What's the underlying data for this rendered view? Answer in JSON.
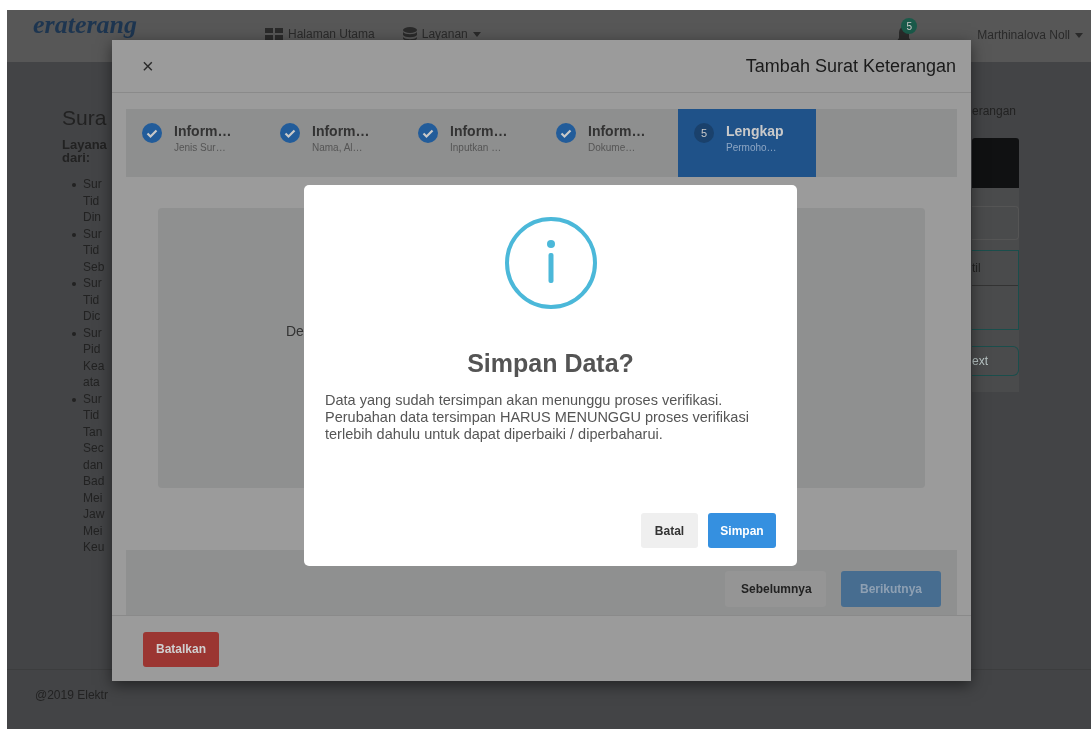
{
  "navbar": {
    "logo": "eraterang",
    "links": [
      {
        "label": "Halaman Utama",
        "kind": "grid",
        "dropdown": false
      },
      {
        "label": "Layanan",
        "kind": "database",
        "dropdown": true
      }
    ],
    "notification_count": "5",
    "user": {
      "name": "Marthinalova Noll",
      "dropdown": true
    }
  },
  "page": {
    "title": "Sura",
    "intro": "Layana\ndari:",
    "list": [
      "Sur\nTid\nDin",
      "Sur\nTid\nSeb",
      "Sur\nTid\nDic",
      "Sur\nPid\nKea\nata",
      "Sur\nTid\nTan\nSec\ndan\nBad\nMei\nJaw\nMei\nKeu"
    ],
    "breadcrumb": "erangan",
    "table_header": "til",
    "next_button": "ext"
  },
  "footer": "@2019 Elektr",
  "modal": {
    "close": "×",
    "title": "Tambah Surat Keterangan",
    "steps": [
      {
        "title": "Inform…",
        "subtitle": "Jenis Sur…",
        "done": true,
        "selected": false
      },
      {
        "title": "Inform…",
        "subtitle": "Nama, Al…",
        "done": true,
        "selected": false
      },
      {
        "title": "Inform…",
        "subtitle": "Inputkan …",
        "done": true,
        "selected": false
      },
      {
        "title": "Inform…",
        "subtitle": "Dokume…",
        "done": true,
        "selected": false
      },
      {
        "number": "5",
        "title": "Lengkap",
        "subtitle": "Permoho…",
        "done": false,
        "selected": true
      }
    ],
    "content_text": "De",
    "prev_button": "Sebelumnya",
    "next_button": "Berikutnya",
    "cancel_button": "Batalkan"
  },
  "alert": {
    "title": "Simpan Data?",
    "message": "Data yang sudah tersimpan akan menunggu proses verifikasi.\nPerubahan data tersimpan HARUS MENUNGGU proses verifikasi terlebih dahulu untuk dapat diperbaiki / diperbaharui.",
    "buttons": [
      {
        "label": "Batal",
        "kind": "secondary"
      },
      {
        "label": "Simpan",
        "kind": "primary"
      }
    ]
  }
}
